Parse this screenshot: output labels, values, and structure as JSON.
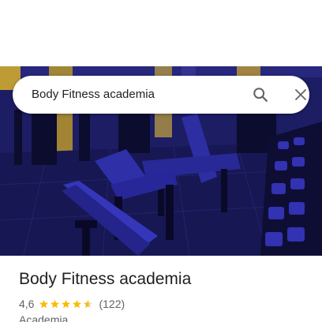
{
  "search": {
    "query": "Body Fitness academia",
    "search_icon": "search-icon",
    "close_icon": "close-icon"
  },
  "hero_image": {
    "description_icon": "gym-photo"
  },
  "place": {
    "title": "Body Fitness academia",
    "rating": "4,6",
    "rating_stars_value": 4.6,
    "review_count": "(122)",
    "category": "Academia"
  },
  "colors": {
    "star": "#fbbc04",
    "star_empty": "#dadce0",
    "title": "#202124",
    "secondary": "#5f6368"
  }
}
